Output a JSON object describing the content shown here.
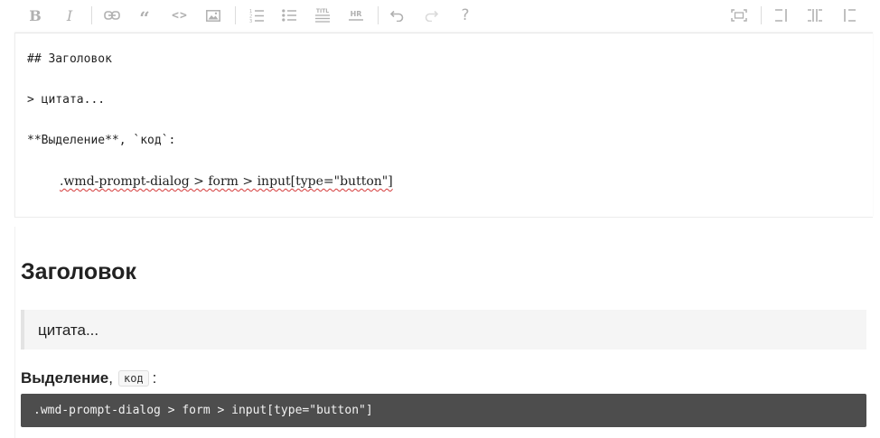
{
  "toolbar": {
    "bold_glyph": "B",
    "italic_glyph": "I",
    "quote_glyph": "“",
    "code_glyph": "<>",
    "help_glyph": "?",
    "title_glyph": "TITL",
    "hr_glyph": "HR",
    "icon_color": "#b0b0b0"
  },
  "editor": {
    "lines": [
      "## Заголовок",
      "> цитата...",
      "**Выделение**, `код`:",
      ".wmd-prompt-dialog > form > input[type=\"button\"]"
    ]
  },
  "preview": {
    "heading": "Заголовок",
    "quote": "цитата...",
    "emphasis": "Выделение",
    "comma": ",",
    "inline_code": "код",
    "colon": ":",
    "code_block": ".wmd-prompt-dialog > form > input[type=\"button\"]"
  }
}
